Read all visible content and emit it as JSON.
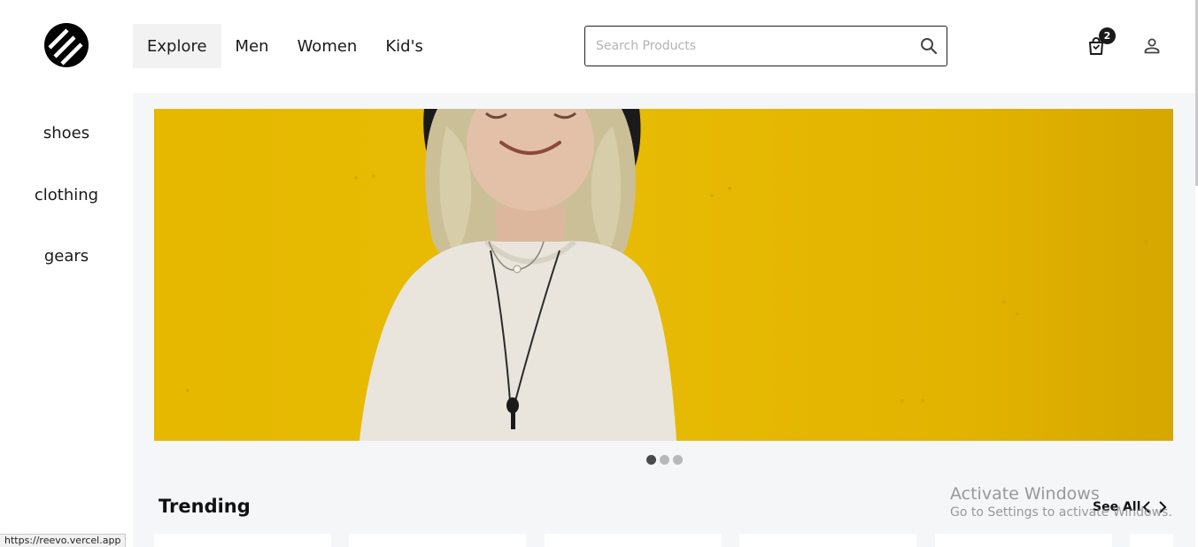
{
  "header": {
    "nav": [
      {
        "label": "Explore",
        "active": true
      },
      {
        "label": "Men",
        "active": false
      },
      {
        "label": "Women",
        "active": false
      },
      {
        "label": "Kid's",
        "active": false
      }
    ],
    "search": {
      "placeholder": "Search Products",
      "value": ""
    },
    "cart": {
      "count": "2",
      "icon": "shopping-bag-icon"
    },
    "user": {
      "icon": "user-icon"
    },
    "logo": {
      "icon": "brand-logo-icon"
    }
  },
  "sidebar": {
    "items": [
      {
        "label": "shoes"
      },
      {
        "label": "clothing"
      },
      {
        "label": "gears"
      }
    ]
  },
  "carousel": {
    "slide_count": 3,
    "active_index": 0,
    "colors": {
      "background": "#e6b800",
      "sweater": "#e9e5dc",
      "hair": "#cbbf98",
      "hat": "#1a1a1a"
    }
  },
  "trending": {
    "title": "Trending",
    "see_all": "See All",
    "card_count": 6
  },
  "system": {
    "status_url": "https://reevo.vercel.app",
    "watermark_title": "Activate Windows",
    "watermark_sub": "Go to Settings to activate Windows."
  }
}
